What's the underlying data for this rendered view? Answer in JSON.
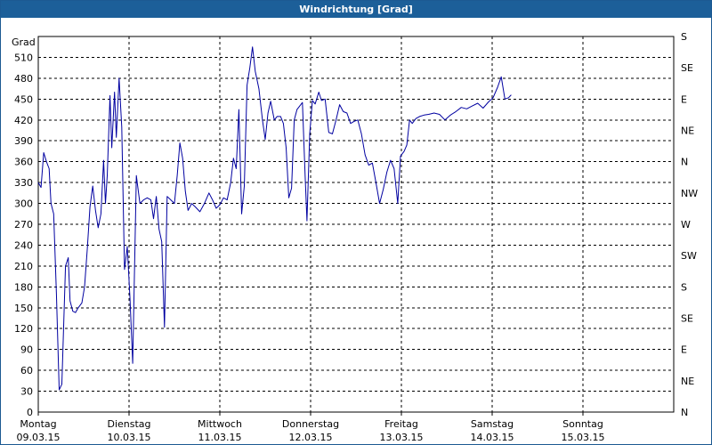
{
  "chart_data": {
    "type": "line",
    "title": "Windrichtung [Grad]",
    "ylabel": "Grad",
    "ylim": [
      0,
      540
    ],
    "yticks": [
      0,
      30,
      60,
      90,
      120,
      150,
      180,
      210,
      240,
      270,
      300,
      330,
      360,
      390,
      420,
      450,
      480,
      510
    ],
    "right_axis_labels": [
      "N",
      "NE",
      "E",
      "SE",
      "S",
      "SW",
      "W",
      "NW",
      "N",
      "NE",
      "E",
      "SE",
      "S"
    ],
    "grid": true,
    "xlim": [
      0,
      7
    ],
    "x_ticks": [
      {
        "x": 0,
        "day": "Montag",
        "date": "09.03.15"
      },
      {
        "x": 1,
        "day": "Dienstag",
        "date": "10.03.15"
      },
      {
        "x": 2,
        "day": "Mittwoch",
        "date": "11.03.15"
      },
      {
        "x": 3,
        "day": "Donnerstag",
        "date": "12.03.15"
      },
      {
        "x": 4,
        "day": "Freitag",
        "date": "13.03.15"
      },
      {
        "x": 5,
        "day": "Samstag",
        "date": "14.03.15"
      },
      {
        "x": 6,
        "day": "Sonntag",
        "date": "15.03.15"
      }
    ],
    "series": [
      {
        "color": "#0000a0",
        "points": [
          [
            0.0,
            330
          ],
          [
            0.03,
            323
          ],
          [
            0.06,
            373
          ],
          [
            0.09,
            360
          ],
          [
            0.12,
            350
          ],
          [
            0.14,
            300
          ],
          [
            0.17,
            285
          ],
          [
            0.2,
            170
          ],
          [
            0.23,
            32
          ],
          [
            0.26,
            40
          ],
          [
            0.3,
            210
          ],
          [
            0.33,
            222
          ],
          [
            0.35,
            160
          ],
          [
            0.38,
            145
          ],
          [
            0.41,
            143
          ],
          [
            0.44,
            150
          ],
          [
            0.48,
            157
          ],
          [
            0.51,
            180
          ],
          [
            0.54,
            235
          ],
          [
            0.57,
            295
          ],
          [
            0.6,
            325
          ],
          [
            0.63,
            290
          ],
          [
            0.66,
            265
          ],
          [
            0.69,
            285
          ],
          [
            0.72,
            362
          ],
          [
            0.74,
            300
          ],
          [
            0.76,
            340
          ],
          [
            0.79,
            455
          ],
          [
            0.81,
            380
          ],
          [
            0.84,
            460
          ],
          [
            0.86,
            395
          ],
          [
            0.89,
            480
          ],
          [
            0.92,
            410
          ],
          [
            0.95,
            205
          ],
          [
            0.98,
            238
          ],
          [
            1.01,
            165
          ],
          [
            1.04,
            70
          ],
          [
            1.08,
            340
          ],
          [
            1.12,
            300
          ],
          [
            1.16,
            305
          ],
          [
            1.2,
            308
          ],
          [
            1.24,
            305
          ],
          [
            1.27,
            278
          ],
          [
            1.3,
            310
          ],
          [
            1.33,
            263
          ],
          [
            1.36,
            245
          ],
          [
            1.39,
            122
          ],
          [
            1.42,
            310
          ],
          [
            1.46,
            305
          ],
          [
            1.5,
            300
          ],
          [
            1.53,
            340
          ],
          [
            1.56,
            387
          ],
          [
            1.59,
            365
          ],
          [
            1.62,
            318
          ],
          [
            1.65,
            290
          ],
          [
            1.69,
            300
          ],
          [
            1.73,
            295
          ],
          [
            1.78,
            288
          ],
          [
            1.83,
            300
          ],
          [
            1.88,
            315
          ],
          [
            1.92,
            305
          ],
          [
            1.96,
            293
          ],
          [
            2.0,
            298
          ],
          [
            2.04,
            308
          ],
          [
            2.08,
            305
          ],
          [
            2.12,
            330
          ],
          [
            2.15,
            365
          ],
          [
            2.18,
            350
          ],
          [
            2.21,
            435
          ],
          [
            2.24,
            285
          ],
          [
            2.27,
            325
          ],
          [
            2.3,
            470
          ],
          [
            2.33,
            495
          ],
          [
            2.36,
            525
          ],
          [
            2.39,
            490
          ],
          [
            2.43,
            465
          ],
          [
            2.47,
            420
          ],
          [
            2.5,
            392
          ],
          [
            2.53,
            430
          ],
          [
            2.56,
            447
          ],
          [
            2.6,
            420
          ],
          [
            2.63,
            425
          ],
          [
            2.67,
            425
          ],
          [
            2.7,
            415
          ],
          [
            2.73,
            380
          ],
          [
            2.76,
            308
          ],
          [
            2.79,
            322
          ],
          [
            2.82,
            420
          ],
          [
            2.85,
            435
          ],
          [
            2.88,
            440
          ],
          [
            2.91,
            445
          ],
          [
            2.94,
            338
          ],
          [
            2.96,
            275
          ],
          [
            2.99,
            400
          ],
          [
            3.02,
            448
          ],
          [
            3.05,
            443
          ],
          [
            3.09,
            460
          ],
          [
            3.12,
            448
          ],
          [
            3.16,
            450
          ],
          [
            3.2,
            402
          ],
          [
            3.24,
            400
          ],
          [
            3.28,
            420
          ],
          [
            3.32,
            442
          ],
          [
            3.36,
            432
          ],
          [
            3.4,
            430
          ],
          [
            3.44,
            415
          ],
          [
            3.48,
            418
          ],
          [
            3.52,
            420
          ],
          [
            3.56,
            400
          ],
          [
            3.6,
            370
          ],
          [
            3.64,
            355
          ],
          [
            3.68,
            358
          ],
          [
            3.72,
            330
          ],
          [
            3.76,
            300
          ],
          [
            3.8,
            320
          ],
          [
            3.84,
            345
          ],
          [
            3.88,
            362
          ],
          [
            3.92,
            350
          ],
          [
            3.96,
            300
          ],
          [
            3.99,
            368
          ],
          [
            4.03,
            375
          ],
          [
            4.06,
            384
          ],
          [
            4.09,
            420
          ],
          [
            4.12,
            415
          ],
          [
            4.16,
            422
          ],
          [
            4.2,
            425
          ],
          [
            4.25,
            427
          ],
          [
            4.3,
            428
          ],
          [
            4.36,
            430
          ],
          [
            4.42,
            428
          ],
          [
            4.48,
            420
          ],
          [
            4.54,
            427
          ],
          [
            4.6,
            432
          ],
          [
            4.66,
            438
          ],
          [
            4.72,
            436
          ],
          [
            4.78,
            440
          ],
          [
            4.84,
            444
          ],
          [
            4.9,
            437
          ],
          [
            4.96,
            446
          ],
          [
            5.01,
            452
          ],
          [
            5.06,
            467
          ],
          [
            5.1,
            482
          ],
          [
            5.14,
            450
          ],
          [
            5.18,
            452
          ],
          [
            5.21,
            456
          ]
        ]
      }
    ]
  }
}
